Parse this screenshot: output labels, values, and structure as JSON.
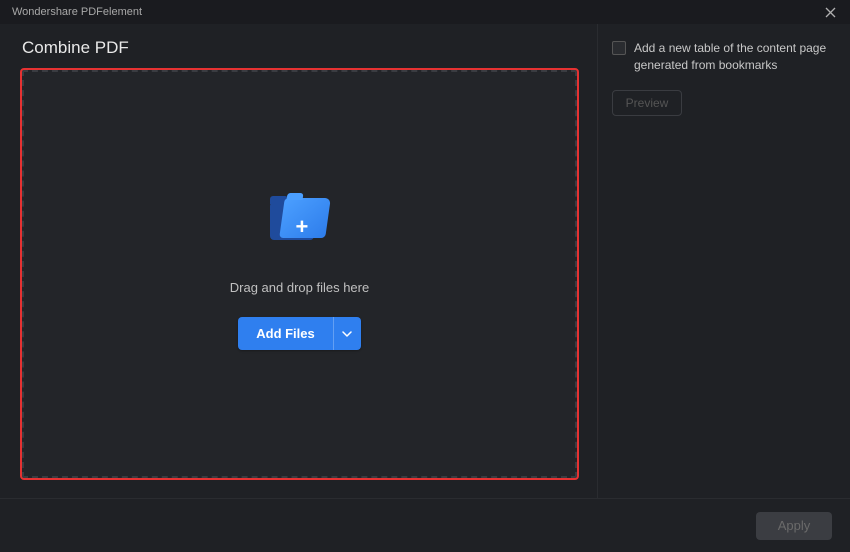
{
  "window": {
    "title": "Wondershare PDFelement"
  },
  "main": {
    "title": "Combine PDF",
    "drop_text": "Drag and drop files here",
    "addfiles_label": "Add Files"
  },
  "sidebar": {
    "checkbox_label": "Add a new table of the content page generated from bookmarks",
    "preview_label": "Preview"
  },
  "footer": {
    "apply_label": "Apply"
  }
}
